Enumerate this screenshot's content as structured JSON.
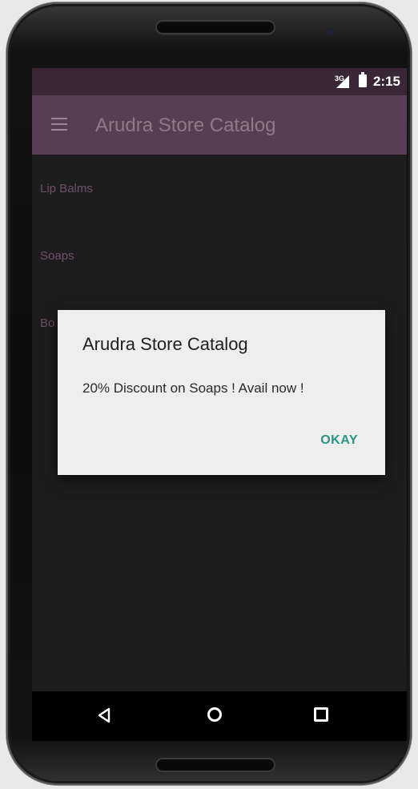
{
  "status_bar": {
    "network": "3G",
    "time": "2:15"
  },
  "app_bar": {
    "title": "Arudra Store Catalog"
  },
  "list": {
    "items": [
      {
        "label": "Lip Balms"
      },
      {
        "label": "Soaps"
      },
      {
        "label": "Bo"
      }
    ]
  },
  "dialog": {
    "title": "Arudra Store Catalog",
    "message": "20% Discount on Soaps ! Avail now !",
    "ok_label": "OKAY"
  },
  "icons": {
    "menu": "hamburger-menu-icon",
    "signal": "cell-signal-icon",
    "battery": "battery-icon",
    "back": "back-triangle-icon",
    "home": "home-circle-icon",
    "recents": "recents-square-icon"
  },
  "colors": {
    "app_bar": "#583e55",
    "status_bar": "#3a2735",
    "screen_bg": "#1d1d1d",
    "list_text": "#6f4f69",
    "dialog_bg": "#eeeeee",
    "accent": "#2a9483"
  }
}
